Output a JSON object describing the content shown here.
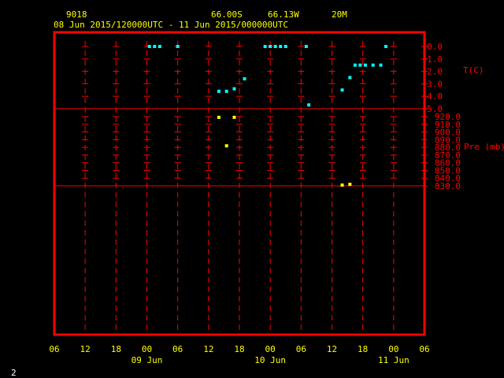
{
  "header": {
    "station": "9018",
    "latitude": "66.00S",
    "longitude": "66.13W",
    "height": "20M",
    "period": "08 Jun 2015/120000UTC - 11 Jun 2015/000000UTC"
  },
  "page_number": "2",
  "colors": {
    "frame": "#ff0000",
    "grid": "#ff0000",
    "text": "#ffff00",
    "temperature": "#00ffff",
    "pressure": "#ffff00",
    "axis_labels": "#ff0000"
  },
  "chart_data": [
    {
      "type": "scatter",
      "series": [
        {
          "name": "T(C)",
          "points": [
            {
              "x": "2015-06-09 00:30",
              "y": 0.0
            },
            {
              "x": "2015-06-09 01:30",
              "y": 0.0
            },
            {
              "x": "2015-06-09 02:30",
              "y": 0.0
            },
            {
              "x": "2015-06-09 06:00",
              "y": 0.0
            },
            {
              "x": "2015-06-09 14:00",
              "y": -3.6
            },
            {
              "x": "2015-06-09 15:30",
              "y": -3.6
            },
            {
              "x": "2015-06-09 17:00",
              "y": -3.4
            },
            {
              "x": "2015-06-09 19:00",
              "y": -2.6
            },
            {
              "x": "2015-06-09 23:00",
              "y": 0.0
            },
            {
              "x": "2015-06-10 00:00",
              "y": 0.0
            },
            {
              "x": "2015-06-10 01:00",
              "y": 0.0
            },
            {
              "x": "2015-06-10 02:00",
              "y": 0.0
            },
            {
              "x": "2015-06-10 03:00",
              "y": 0.0
            },
            {
              "x": "2015-06-10 07:00",
              "y": 0.0
            },
            {
              "x": "2015-06-10 07:30",
              "y": -4.7
            },
            {
              "x": "2015-06-10 14:00",
              "y": -3.5
            },
            {
              "x": "2015-06-10 15:30",
              "y": -2.5
            },
            {
              "x": "2015-06-10 16:30",
              "y": -1.5
            },
            {
              "x": "2015-06-10 17:30",
              "y": -1.5
            },
            {
              "x": "2015-06-10 18:30",
              "y": -1.5
            },
            {
              "x": "2015-06-10 20:00",
              "y": -1.5
            },
            {
              "x": "2015-06-10 21:30",
              "y": -1.5
            },
            {
              "x": "2015-06-10 22:30",
              "y": 0.0
            }
          ]
        }
      ],
      "ylabel": "T(C)",
      "yticks": [
        "0.0",
        "-1.0",
        "-2.0",
        "-3.0",
        "-4.0",
        "-5.0"
      ],
      "ylim": [
        -5.0,
        0.0
      ],
      "grid": true
    },
    {
      "type": "scatter",
      "series": [
        {
          "name": "Pre (mb)",
          "points": [
            {
              "x": "2015-06-09 14:00",
              "y": 919
            },
            {
              "x": "2015-06-09 15:30",
              "y": 882
            },
            {
              "x": "2015-06-09 17:00",
              "y": 919
            },
            {
              "x": "2015-06-10 14:00",
              "y": 831
            },
            {
              "x": "2015-06-10 15:30",
              "y": 832
            }
          ]
        }
      ],
      "ylabel": "Pre (mb)",
      "yticks": [
        "920.0",
        "910.0",
        "900.0",
        "890.0",
        "880.0",
        "870.0",
        "860.0",
        "850.0",
        "840.0",
        "830.0"
      ],
      "ylim": [
        825.0,
        925.0
      ],
      "grid": true
    }
  ],
  "x_axis": {
    "range": [
      "2015-06-08 06:00",
      "2015-06-11 06:00"
    ],
    "ticks": [
      "06",
      "12",
      "18",
      "00",
      "06",
      "12",
      "18",
      "00",
      "06",
      "12",
      "18",
      "00",
      "06"
    ],
    "date_labels": [
      "09 Jun",
      "10 Jun",
      "11 Jun"
    ]
  }
}
